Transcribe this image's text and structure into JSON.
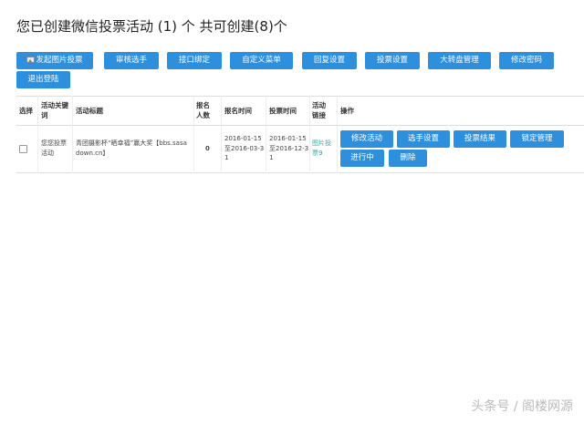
{
  "page": {
    "title": "您已创建微信投票活动 (1) 个 共可创建(8)个"
  },
  "toolbar": {
    "buttons": [
      {
        "label": "发起图片投票"
      },
      {
        "label": "审核选手"
      },
      {
        "label": "接口绑定"
      },
      {
        "label": "自定义菜单"
      },
      {
        "label": "回复设置"
      },
      {
        "label": "投票设置"
      },
      {
        "label": "大转盘管理"
      },
      {
        "label": "修改密码"
      },
      {
        "label": "退出登陆"
      }
    ],
    "accent_color": "#2e8fdc"
  },
  "table": {
    "headers": {
      "select": "选择",
      "keyword": "活动关键词",
      "title": "活动标题",
      "signup_count": "报名人数",
      "signup_time": "报名时间",
      "vote_time": "投票时间",
      "link": "活动链接",
      "actions": "操作"
    },
    "rows": [
      {
        "keyword": "您您投票活动",
        "title": "青团摄影杯“晒幸福”赢大奖【bbs.sasadown.cn】",
        "signup_count": "0",
        "signup_time": "2016-01-15至2016-03-31",
        "vote_time": "2016-01-15至2016-12-31",
        "link": "图片投票9",
        "actions": {
          "edit": "修改活动",
          "players": "选手设置",
          "results": "投票结果",
          "lock": "锁定管理",
          "status": "进行中",
          "delete": "删除"
        }
      }
    ]
  },
  "watermark": "头条号 / 阁楼网源"
}
